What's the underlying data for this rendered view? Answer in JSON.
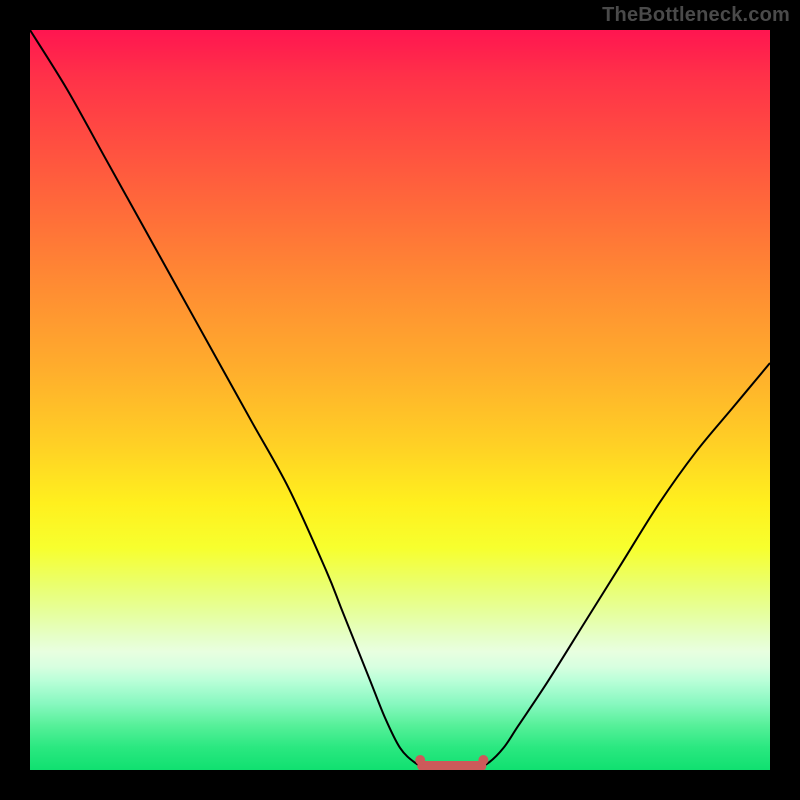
{
  "watermark": "TheBottleneck.com",
  "colors": {
    "frame": "#000000",
    "curve": "#000000",
    "flat_region": "#cc5a5a",
    "gradient_top": "#ff1550",
    "gradient_bottom": "#10e070"
  },
  "chart_data": {
    "type": "line",
    "title": "",
    "xlabel": "",
    "ylabel": "",
    "xlim": [
      0,
      100
    ],
    "ylim": [
      0,
      100
    ],
    "series": [
      {
        "name": "bottleneck-curve",
        "x": [
          0,
          5,
          10,
          15,
          20,
          25,
          30,
          35,
          40,
          42,
          44,
          46,
          48,
          50,
          52,
          54,
          56,
          58,
          60,
          62,
          64,
          66,
          70,
          75,
          80,
          85,
          90,
          95,
          100
        ],
        "y": [
          100,
          92,
          83,
          74,
          65,
          56,
          47,
          38,
          27,
          22,
          17,
          12,
          7,
          3,
          1,
          0,
          0,
          0,
          0,
          1,
          3,
          6,
          12,
          20,
          28,
          36,
          43,
          49,
          55
        ]
      }
    ],
    "annotations": [
      {
        "name": "optimal-zone",
        "x_range": [
          53,
          61
        ],
        "y": 0,
        "color": "#cc5a5a"
      }
    ],
    "background": "rainbow-vertical-gradient",
    "grid": false,
    "legend": false
  }
}
